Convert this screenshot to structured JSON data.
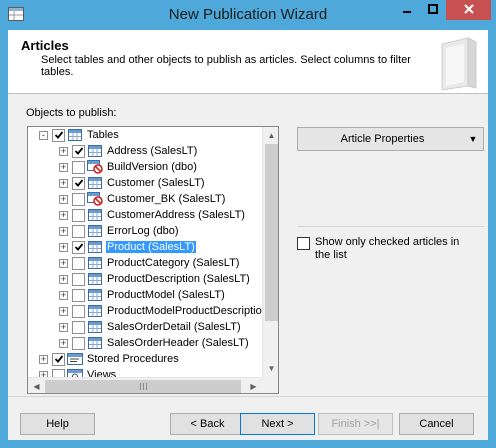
{
  "window": {
    "title": "New Publication Wizard"
  },
  "header": {
    "title": "Articles",
    "description": "Select tables and other objects to publish as articles. Select columns to filter tables."
  },
  "objects_label": "Objects to publish:",
  "tree": {
    "items": [
      {
        "label": "Tables",
        "level": 0,
        "expander": "-",
        "checked": true,
        "icon": "folder-table-icon"
      },
      {
        "label": "Address (SalesLT)",
        "level": 1,
        "expander": "+",
        "checked": true,
        "icon": "table-icon"
      },
      {
        "label": "BuildVersion (dbo)",
        "level": 1,
        "expander": "+",
        "checked": false,
        "icon": "table-blocked-icon"
      },
      {
        "label": "Customer (SalesLT)",
        "level": 1,
        "expander": "+",
        "checked": true,
        "icon": "table-icon"
      },
      {
        "label": "Customer_BK (SalesLT)",
        "level": 1,
        "expander": "+",
        "checked": false,
        "icon": "table-blocked-icon"
      },
      {
        "label": "CustomerAddress (SalesLT)",
        "level": 1,
        "expander": "+",
        "checked": false,
        "icon": "table-icon"
      },
      {
        "label": "ErrorLog (dbo)",
        "level": 1,
        "expander": "+",
        "checked": false,
        "icon": "table-icon"
      },
      {
        "label": "Product (SalesLT)",
        "level": 1,
        "expander": "+",
        "checked": true,
        "icon": "table-icon",
        "selected": true
      },
      {
        "label": "ProductCategory (SalesLT)",
        "level": 1,
        "expander": "+",
        "checked": false,
        "icon": "table-icon"
      },
      {
        "label": "ProductDescription (SalesLT)",
        "level": 1,
        "expander": "+",
        "checked": false,
        "icon": "table-icon"
      },
      {
        "label": "ProductModel (SalesLT)",
        "level": 1,
        "expander": "+",
        "checked": false,
        "icon": "table-icon"
      },
      {
        "label": "ProductModelProductDescription (S",
        "level": 1,
        "expander": "+",
        "checked": false,
        "icon": "table-icon"
      },
      {
        "label": "SalesOrderDetail (SalesLT)",
        "level": 1,
        "expander": "+",
        "checked": false,
        "icon": "table-icon"
      },
      {
        "label": "SalesOrderHeader (SalesLT)",
        "level": 1,
        "expander": "+",
        "checked": false,
        "icon": "table-icon"
      },
      {
        "label": "Stored Procedures",
        "level": 0,
        "expander": "+",
        "checked": true,
        "icon": "folder-procedure-icon"
      },
      {
        "label": "Views",
        "level": 0,
        "expander": "+",
        "checked": false,
        "icon": "folder-view-icon"
      }
    ]
  },
  "article_properties": {
    "label": "Article Properties"
  },
  "show_only_checked": {
    "label": "Show only checked articles in the list",
    "checked": false
  },
  "buttons": {
    "help": "Help",
    "back": "< Back",
    "next": "Next >",
    "finish": "Finish >>|",
    "cancel": "Cancel"
  },
  "colors": {
    "title_bar": "#4ea8d9",
    "close_button": "#c75050",
    "selection": "#3399ff"
  }
}
